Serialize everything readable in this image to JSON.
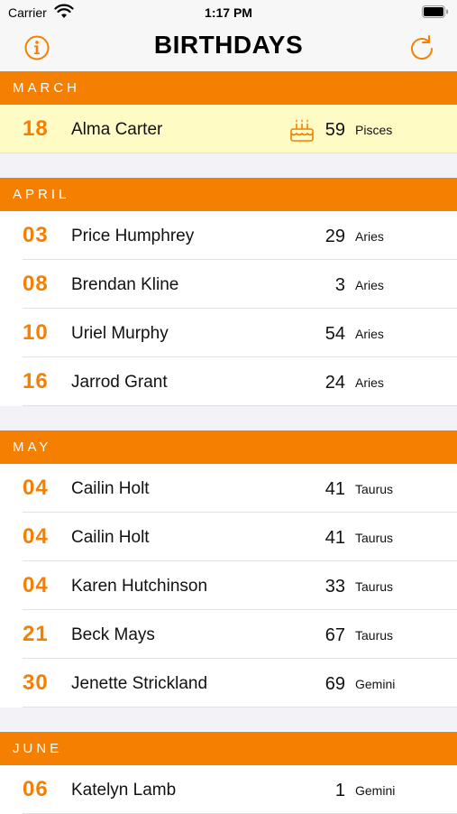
{
  "status_bar": {
    "carrier": "Carrier",
    "time": "1:17 PM"
  },
  "nav": {
    "title": "BIRTHDAYS",
    "left_icon": "info-icon",
    "right_icon": "refresh-icon"
  },
  "colors": {
    "accent": "#f57f00",
    "highlight": "#fffbc4"
  },
  "sections": [
    {
      "month": "MARCH",
      "rows": [
        {
          "day": "18",
          "name": "Alma Carter",
          "age": "59",
          "sign": "Pisces",
          "today": true
        }
      ]
    },
    {
      "month": "APRIL",
      "rows": [
        {
          "day": "03",
          "name": "Price Humphrey",
          "age": "29",
          "sign": "Aries"
        },
        {
          "day": "08",
          "name": "Brendan Kline",
          "age": "3",
          "sign": "Aries"
        },
        {
          "day": "10",
          "name": "Uriel Murphy",
          "age": "54",
          "sign": "Aries"
        },
        {
          "day": "16",
          "name": "Jarrod Grant",
          "age": "24",
          "sign": "Aries"
        }
      ]
    },
    {
      "month": "MAY",
      "rows": [
        {
          "day": "04",
          "name": "Cailin Holt",
          "age": "41",
          "sign": "Taurus"
        },
        {
          "day": "04",
          "name": "Cailin Holt",
          "age": "41",
          "sign": "Taurus"
        },
        {
          "day": "04",
          "name": "Karen Hutchinson",
          "age": "33",
          "sign": "Taurus"
        },
        {
          "day": "21",
          "name": "Beck Mays",
          "age": "67",
          "sign": "Taurus"
        },
        {
          "day": "30",
          "name": "Jenette Strickland",
          "age": "69",
          "sign": "Gemini"
        }
      ]
    },
    {
      "month": "JUNE",
      "rows": [
        {
          "day": "06",
          "name": "Katelyn Lamb",
          "age": "1",
          "sign": "Gemini"
        }
      ]
    }
  ]
}
